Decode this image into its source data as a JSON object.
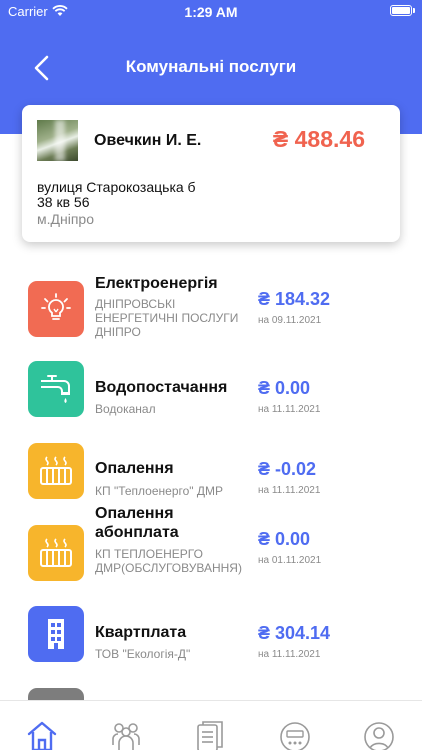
{
  "status_bar": {
    "carrier": "Carrier",
    "time": "1:29 AM"
  },
  "header": {
    "title": "Комунальні послуги"
  },
  "account": {
    "owner": "Овечкин И. Е.",
    "total": "₴ 488.46",
    "street": "вулиця Старокозацька б",
    "house": "38 кв 56",
    "city": "м.Дніпро"
  },
  "services": [
    {
      "name": "Електроенергія",
      "provider": "ДНІПРОВСЬКІ ЕНЕРГЕТИЧНІ ПОСЛУГИ ДНІПРО",
      "amount": "₴ 184.32",
      "date": "на 09.11.2021",
      "icon": "lightbulb-icon",
      "color": "#f16b53"
    },
    {
      "name": "Водопостачання",
      "provider": "Водоканал",
      "amount": "₴ 0.00",
      "date": "на 11.11.2021",
      "icon": "water-tap-icon",
      "color": "#2fc39b"
    },
    {
      "name": "Опалення",
      "provider": "КП \"Теплоенерго\" ДМР",
      "amount": "₴ -0.02",
      "date": "на 11.11.2021",
      "icon": "radiator-icon",
      "color": "#f7b52c"
    },
    {
      "name": "Опалення абонплата",
      "provider": "КП ТЕПЛОЕНЕРГО ДМР(ОБСЛУГОВУВАННЯ)",
      "amount": "₴ 0.00",
      "date": "на 01.11.2021",
      "icon": "radiator-icon",
      "color": "#f7b52c"
    },
    {
      "name": "Квартплата",
      "provider": "ТОВ \"Екологія-Д\"",
      "amount": "₴ 304.14",
      "date": "на 11.11.2021",
      "icon": "building-icon",
      "color": "#4f6cf1"
    }
  ],
  "colors": {
    "accent": "#4f6cf1",
    "total": "#f0634f"
  },
  "tabs": [
    "home-icon",
    "people-icon",
    "documents-icon",
    "meter-icon",
    "profile-icon"
  ]
}
